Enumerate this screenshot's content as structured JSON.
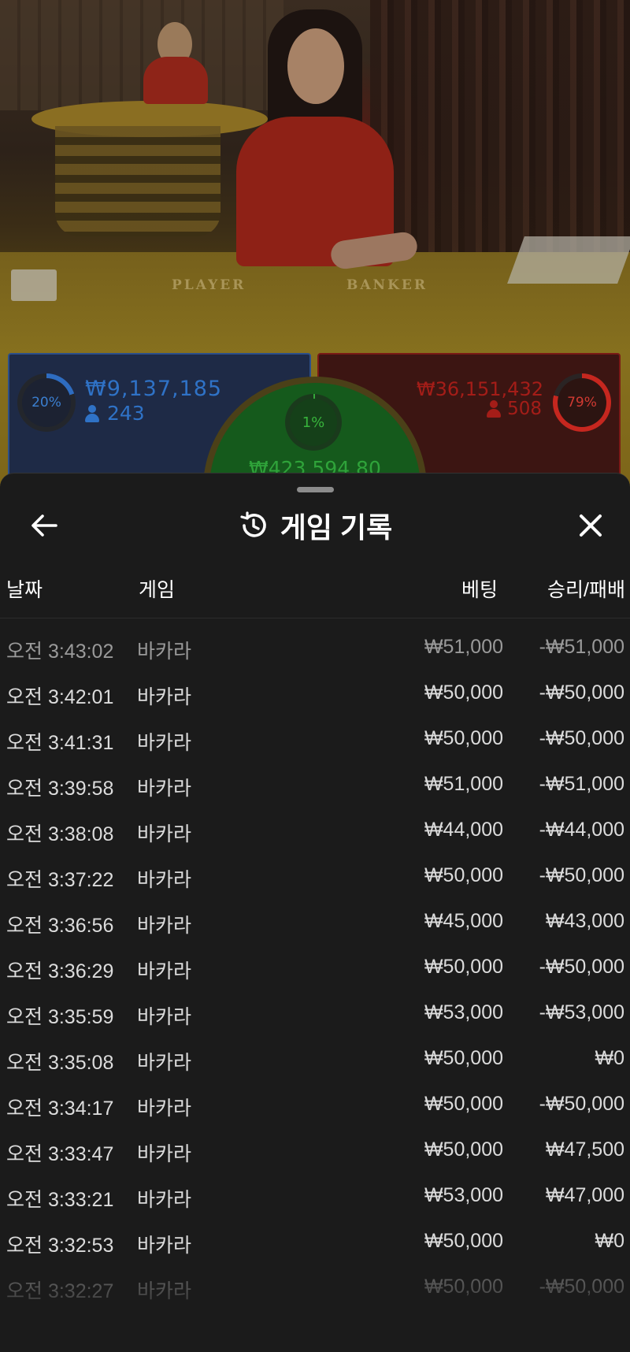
{
  "video": {
    "player_label": "PLAYER",
    "banker_label": "BANKER"
  },
  "bets": {
    "player": {
      "percent": "20%",
      "amount": "₩9,137,185",
      "count": "243",
      "color": "#2f72c6"
    },
    "banker": {
      "percent": "79%",
      "amount": "₩36,151,432",
      "count": "508",
      "color": "#c6271f"
    },
    "tie": {
      "percent": "1%",
      "amount": "₩423,594.80",
      "color": "#34a83a"
    }
  },
  "sheet": {
    "title": "게임 기록",
    "icons": {
      "back": "arrow-left-icon",
      "history": "history-icon",
      "close": "close-icon"
    },
    "columns": {
      "date": "날짜",
      "game": "게임",
      "bet": "베팅",
      "winloss": "승리/패배"
    },
    "rows": [
      {
        "time": "오전 3:43:02",
        "game": "바카라",
        "bet": "₩51,000",
        "winloss": "-₩51,000"
      },
      {
        "time": "오전 3:42:01",
        "game": "바카라",
        "bet": "₩50,000",
        "winloss": "-₩50,000"
      },
      {
        "time": "오전 3:41:31",
        "game": "바카라",
        "bet": "₩50,000",
        "winloss": "-₩50,000"
      },
      {
        "time": "오전 3:39:58",
        "game": "바카라",
        "bet": "₩51,000",
        "winloss": "-₩51,000"
      },
      {
        "time": "오전 3:38:08",
        "game": "바카라",
        "bet": "₩44,000",
        "winloss": "-₩44,000"
      },
      {
        "time": "오전 3:37:22",
        "game": "바카라",
        "bet": "₩50,000",
        "winloss": "-₩50,000"
      },
      {
        "time": "오전 3:36:56",
        "game": "바카라",
        "bet": "₩45,000",
        "winloss": "₩43,000"
      },
      {
        "time": "오전 3:36:29",
        "game": "바카라",
        "bet": "₩50,000",
        "winloss": "-₩50,000"
      },
      {
        "time": "오전 3:35:59",
        "game": "바카라",
        "bet": "₩53,000",
        "winloss": "-₩53,000"
      },
      {
        "time": "오전 3:35:08",
        "game": "바카라",
        "bet": "₩50,000",
        "winloss": "₩0"
      },
      {
        "time": "오전 3:34:17",
        "game": "바카라",
        "bet": "₩50,000",
        "winloss": "-₩50,000"
      },
      {
        "time": "오전 3:33:47",
        "game": "바카라",
        "bet": "₩50,000",
        "winloss": "₩47,500"
      },
      {
        "time": "오전 3:33:21",
        "game": "바카라",
        "bet": "₩53,000",
        "winloss": "₩47,000"
      },
      {
        "time": "오전 3:32:53",
        "game": "바카라",
        "bet": "₩50,000",
        "winloss": "₩0"
      },
      {
        "time": "오전 3:32:27",
        "game": "바카라",
        "bet": "₩50,000",
        "winloss": "-₩50,000"
      }
    ]
  }
}
